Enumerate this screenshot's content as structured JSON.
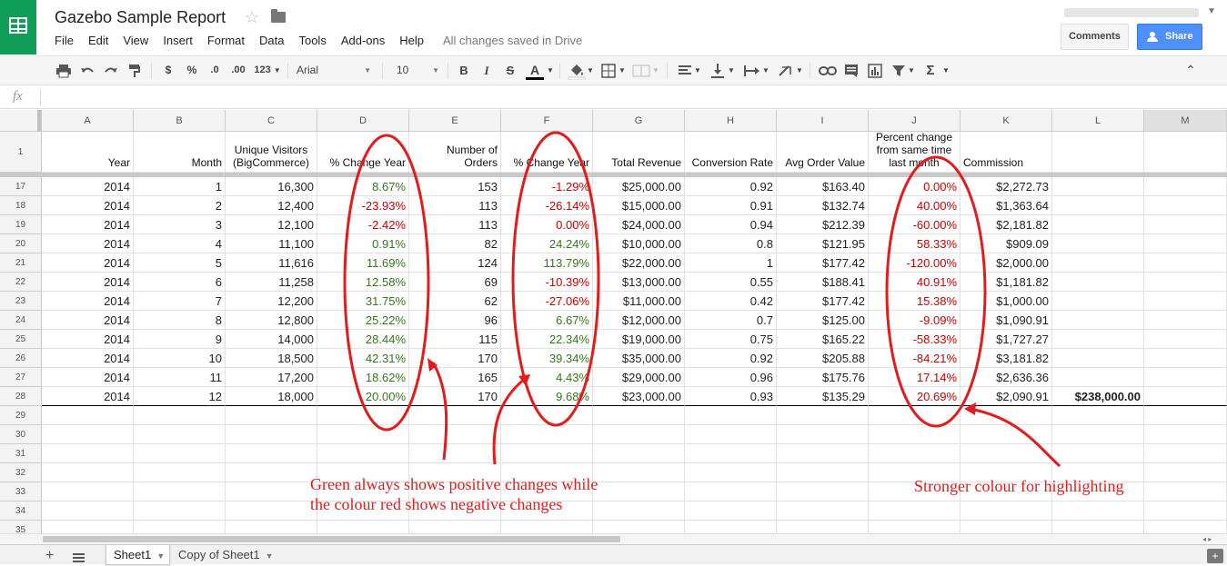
{
  "app": {
    "doc_title": "Gazebo Sample Report",
    "menu": [
      "File",
      "Edit",
      "View",
      "Insert",
      "Format",
      "Data",
      "Tools",
      "Add-ons",
      "Help"
    ],
    "save_status": "All changes saved in Drive",
    "comments_label": "Comments",
    "share_label": "Share"
  },
  "toolbar": {
    "currency": "$",
    "percent": "%",
    "dec_decrease": ".0",
    "dec_increase": ".00",
    "more_formats": "123",
    "font": "Arial",
    "font_size": "10",
    "bold": "B",
    "italic": "I",
    "strike": "S",
    "text_color": "A",
    "functions": "Σ"
  },
  "formula_bar": {
    "fx": "fx",
    "value": ""
  },
  "columns": [
    "A",
    "B",
    "C",
    "D",
    "E",
    "F",
    "G",
    "H",
    "I",
    "J",
    "K",
    "L",
    "M"
  ],
  "header_row": {
    "row_number": "1",
    "cells": [
      "Year",
      "Month",
      "Unique Visitors (BigCommerce)",
      "% Change Year",
      "Number of Orders",
      "% Change Year",
      "Total Revenue",
      "Conversion Rate",
      "Avg Order Value",
      "Percent change from same time last month",
      "Commission",
      "",
      ""
    ]
  },
  "rows": [
    {
      "n": "17",
      "cells": [
        "2014",
        "1",
        "16,300",
        "8.67%",
        "153",
        "-1.29%",
        "$25,000.00",
        "0.92",
        "$163.40",
        "0.00%",
        "$2,272.73",
        "",
        ""
      ]
    },
    {
      "n": "18",
      "cells": [
        "2014",
        "2",
        "12,400",
        "-23.93%",
        "113",
        "-26.14%",
        "$15,000.00",
        "0.91",
        "$132.74",
        "40.00%",
        "$1,363.64",
        "",
        ""
      ]
    },
    {
      "n": "19",
      "cells": [
        "2014",
        "3",
        "12,100",
        "-2.42%",
        "113",
        "0.00%",
        "$24,000.00",
        "0.94",
        "$212.39",
        "-60.00%",
        "$2,181.82",
        "",
        ""
      ]
    },
    {
      "n": "20",
      "cells": [
        "2014",
        "4",
        "11,100",
        "0.91%",
        "82",
        "24.24%",
        "$10,000.00",
        "0.8",
        "$121.95",
        "58.33%",
        "$909.09",
        "",
        ""
      ]
    },
    {
      "n": "21",
      "cells": [
        "2014",
        "5",
        "11,616",
        "11.69%",
        "124",
        "113.79%",
        "$22,000.00",
        "1",
        "$177.42",
        "-120.00%",
        "$2,000.00",
        "",
        ""
      ]
    },
    {
      "n": "22",
      "cells": [
        "2014",
        "6",
        "11,258",
        "12.58%",
        "69",
        "-10.39%",
        "$13,000.00",
        "0.55",
        "$188.41",
        "40.91%",
        "$1,181.82",
        "",
        ""
      ]
    },
    {
      "n": "23",
      "cells": [
        "2014",
        "7",
        "12,200",
        "31.75%",
        "62",
        "-27.06%",
        "$11,000.00",
        "0.42",
        "$177.42",
        "15.38%",
        "$1,000.00",
        "",
        ""
      ]
    },
    {
      "n": "24",
      "cells": [
        "2014",
        "8",
        "12,800",
        "25.22%",
        "96",
        "6.67%",
        "$12,000.00",
        "0.7",
        "$125.00",
        "-9.09%",
        "$1,090.91",
        "",
        ""
      ]
    },
    {
      "n": "25",
      "cells": [
        "2014",
        "9",
        "14,000",
        "28.44%",
        "115",
        "22.34%",
        "$19,000.00",
        "0.75",
        "$165.22",
        "-58.33%",
        "$1,727.27",
        "",
        ""
      ]
    },
    {
      "n": "26",
      "cells": [
        "2014",
        "10",
        "18,500",
        "42.31%",
        "170",
        "39.34%",
        "$35,000.00",
        "0.92",
        "$205.88",
        "-84.21%",
        "$3,181.82",
        "",
        ""
      ]
    },
    {
      "n": "27",
      "cells": [
        "2014",
        "11",
        "17,200",
        "18.62%",
        "165",
        "4.43%",
        "$29,000.00",
        "0.96",
        "$175.76",
        "17.14%",
        "$2,636.36",
        "",
        ""
      ]
    },
    {
      "n": "28",
      "cells": [
        "2014",
        "12",
        "18,000",
        "20.00%",
        "170",
        "9.68%",
        "$23,000.00",
        "0.93",
        "$135.29",
        "20.69%",
        "$2,090.91",
        "$238,000.00",
        ""
      ]
    },
    {
      "n": "29",
      "cells": [
        "",
        "",
        "",
        "",
        "",
        "",
        "",
        "",
        "",
        "",
        "",
        "",
        ""
      ]
    },
    {
      "n": "30",
      "cells": [
        "",
        "",
        "",
        "",
        "",
        "",
        "",
        "",
        "",
        "",
        "",
        "",
        ""
      ]
    },
    {
      "n": "31",
      "cells": [
        "",
        "",
        "",
        "",
        "",
        "",
        "",
        "",
        "",
        "",
        "",
        "",
        ""
      ]
    },
    {
      "n": "32",
      "cells": [
        "",
        "",
        "",
        "",
        "",
        "",
        "",
        "",
        "",
        "",
        "",
        "",
        ""
      ]
    },
    {
      "n": "33",
      "cells": [
        "",
        "",
        "",
        "",
        "",
        "",
        "",
        "",
        "",
        "",
        "",
        "",
        ""
      ]
    },
    {
      "n": "34",
      "cells": [
        "",
        "",
        "",
        "",
        "",
        "",
        "",
        "",
        "",
        "",
        "",
        "",
        ""
      ]
    },
    {
      "n": "35",
      "cells": [
        "",
        "",
        "",
        "",
        "",
        "",
        "",
        "",
        "",
        "",
        "",
        "",
        ""
      ]
    }
  ],
  "cell_colors": {
    "D": "#38761d",
    "F": "#38761d",
    "J": "#cc0000",
    "negative": "#cc0000",
    "positive": "#38761d"
  },
  "annotations": {
    "left_note": "Green always shows positive changes while\nthe colour red shows negative changes",
    "right_note": "Stronger colour for highlighting",
    "color": "#e41b1b"
  },
  "sheets": [
    {
      "name": "Sheet1",
      "active": true
    },
    {
      "name": "Copy of Sheet1",
      "active": false
    }
  ]
}
